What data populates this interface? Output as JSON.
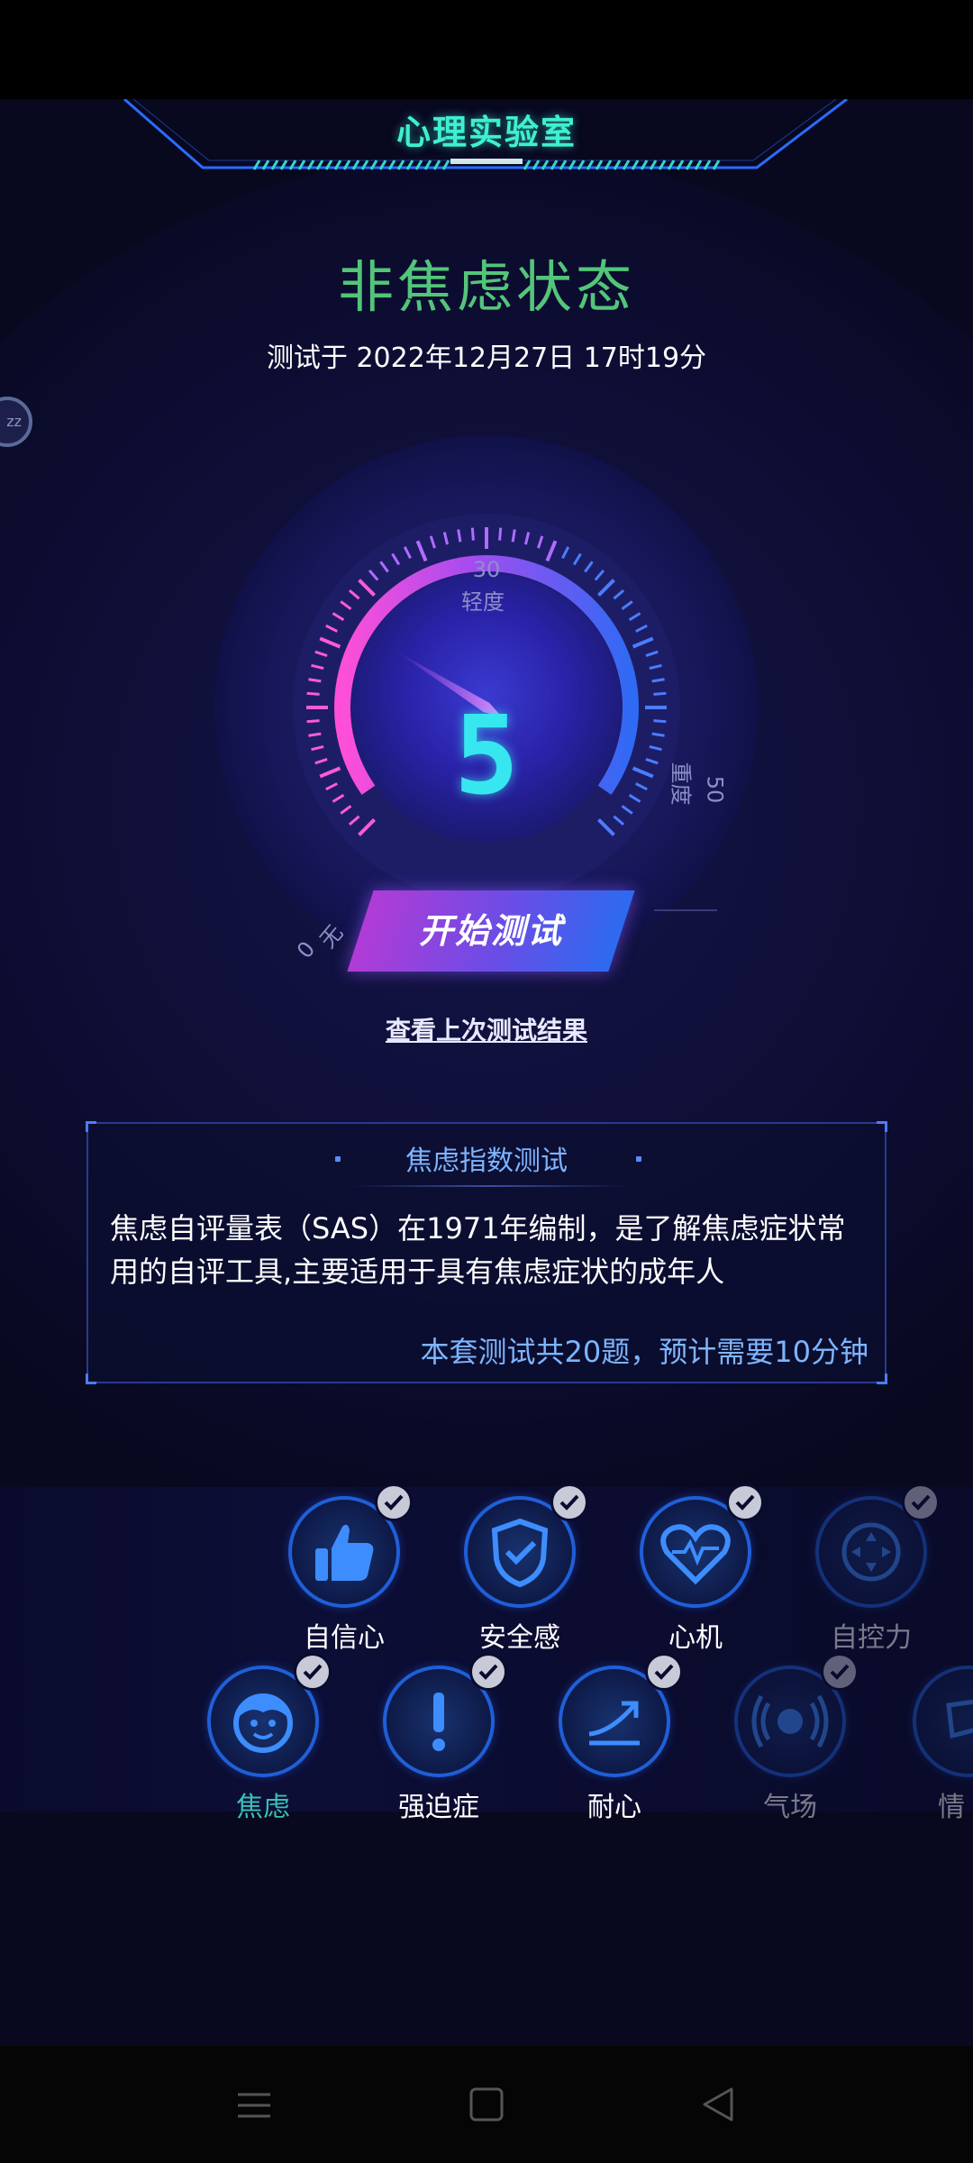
{
  "header": {
    "title": "心理实验室"
  },
  "result": {
    "status": "非焦虑状态",
    "tested_at": "测试于 2022年12月27日 17时19分",
    "score": "5"
  },
  "gauge": {
    "label_low_num": "0",
    "label_low": "无",
    "label_mid_num": "30",
    "label_mid": "轻度",
    "label_high_num": "50",
    "label_high": "重度",
    "score_value": 5
  },
  "actions": {
    "start_test": "开始测试",
    "view_last": "查看上次测试结果"
  },
  "side_handle": {
    "label": "zz"
  },
  "info_card": {
    "title": "焦虑指数测试",
    "description": "焦虑自评量表（SAS）在1971年编制，是了解焦虑症状常用的自评工具,主要适用于具有焦虑症状的成年人",
    "footer": "本套测试共20题，预计需要10分钟"
  },
  "categories_row1": [
    {
      "label": "自信心",
      "icon": "thumbs-up-icon"
    },
    {
      "label": "安全感",
      "icon": "shield-check-icon"
    },
    {
      "label": "心机",
      "icon": "heart-pulse-icon"
    },
    {
      "label": "自控力",
      "icon": "dpad-icon"
    }
  ],
  "categories_row2": [
    {
      "label": "焦虑",
      "icon": "face-icon"
    },
    {
      "label": "强迫症",
      "icon": "exclamation-icon"
    },
    {
      "label": "耐心",
      "icon": "trend-arrow-icon"
    },
    {
      "label": "气场",
      "icon": "broadcast-icon"
    },
    {
      "label": "情",
      "icon": "partial-icon"
    }
  ],
  "colors": {
    "header_accent": "#3ef0d0",
    "status_green": "#53c57a",
    "score_cyan": "#36e7f0",
    "card_blue": "#7db5ff",
    "active_category": "#39c0b4"
  }
}
